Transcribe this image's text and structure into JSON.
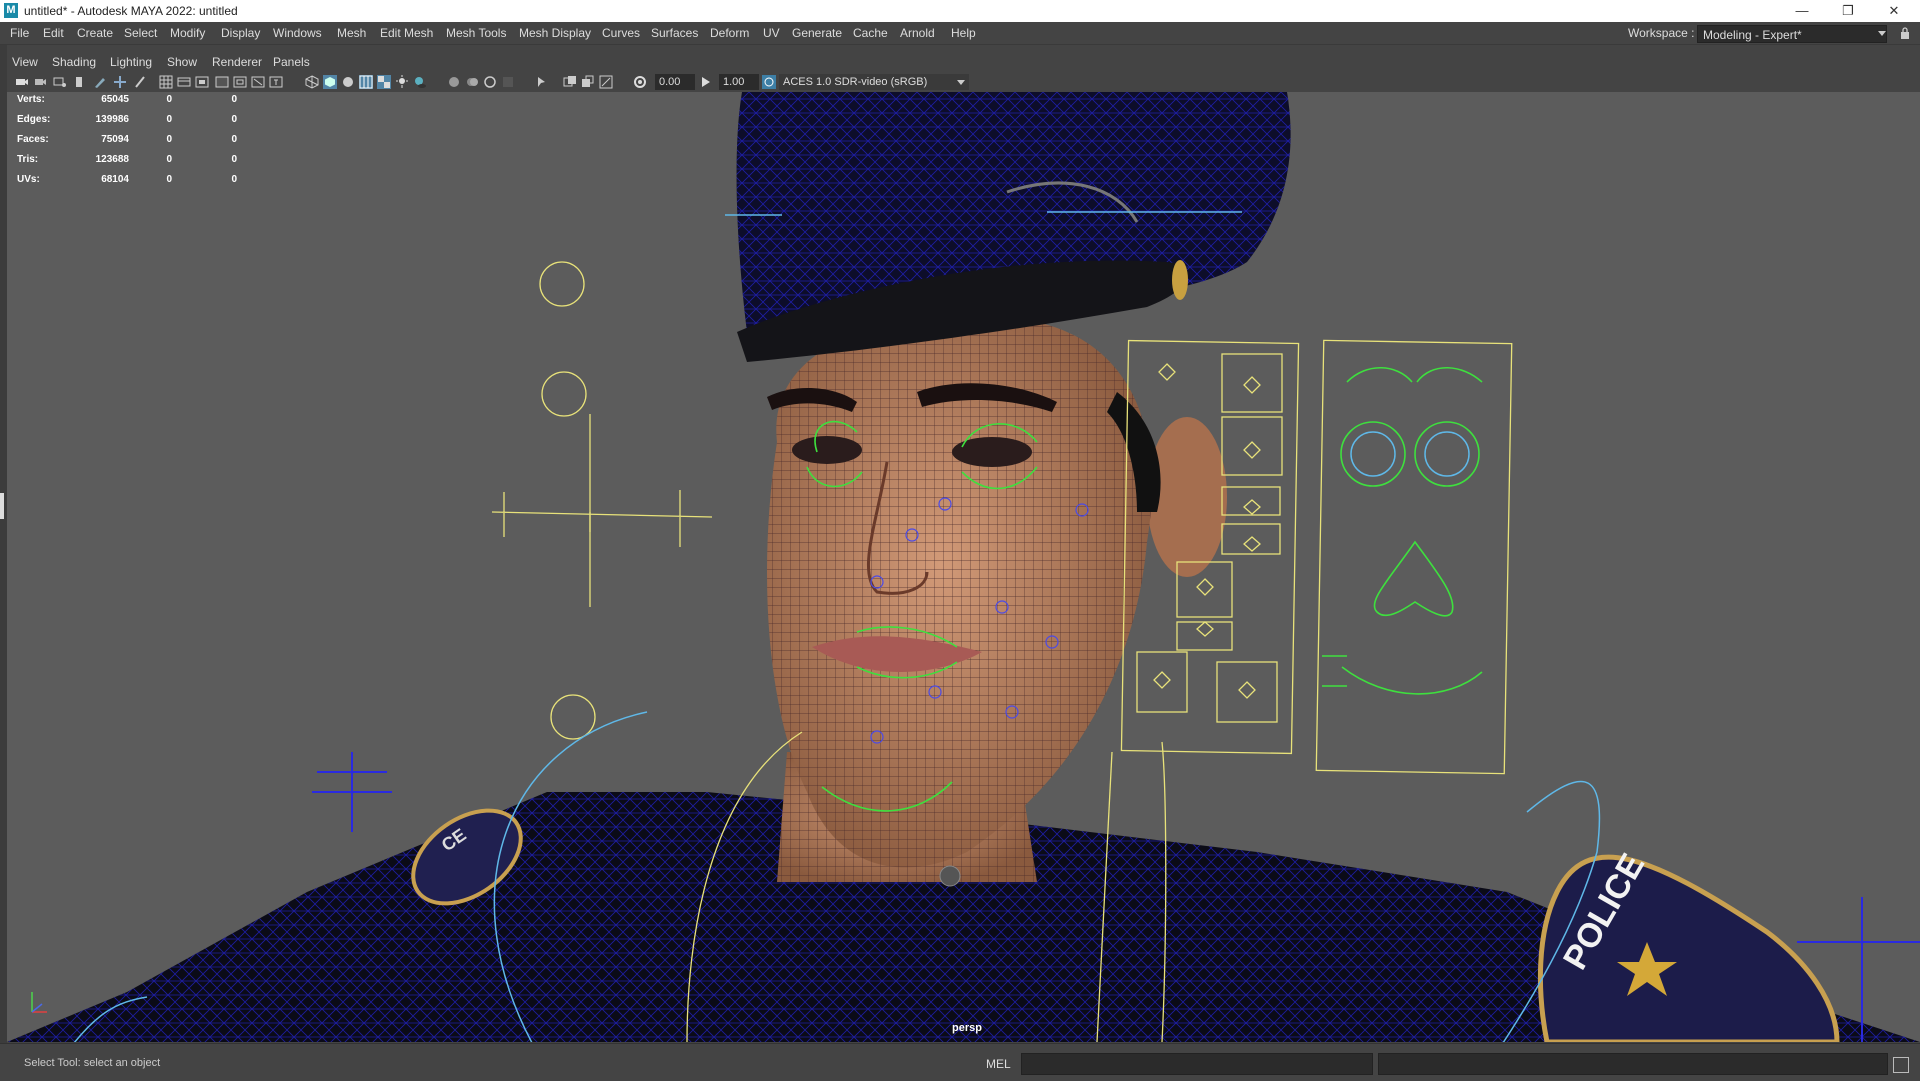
{
  "window": {
    "title": "untitled* - Autodesk MAYA 2022: untitled",
    "app_icon": "maya-icon",
    "controls": [
      "minimize-icon",
      "restore-icon",
      "close-icon"
    ]
  },
  "menubar": {
    "items": [
      "File",
      "Edit",
      "Create",
      "Select",
      "Modify",
      "Display",
      "Windows",
      "Mesh",
      "Edit Mesh",
      "Mesh Tools",
      "Mesh Display",
      "Curves",
      "Surfaces",
      "Deform",
      "UV",
      "Generate",
      "Cache",
      "Arnold",
      "Help"
    ],
    "workspace_label": "Workspace :",
    "workspace_value": "Modeling - Expert*"
  },
  "panel_menu": {
    "items": [
      "View",
      "Shading",
      "Lighting",
      "Show",
      "Renderer",
      "Panels"
    ]
  },
  "panel_toolbar": {
    "exposure_value": "0.00",
    "gamma_value": "1.00",
    "color_space": "ACES 1.0 SDR-video (sRGB)"
  },
  "hud": {
    "rows": [
      {
        "label": "Verts:",
        "a": "65045",
        "b": "0",
        "c": "0"
      },
      {
        "label": "Edges:",
        "a": "139986",
        "b": "0",
        "c": "0"
      },
      {
        "label": "Faces:",
        "a": "75094",
        "b": "0",
        "c": "0"
      },
      {
        "label": "Tris:",
        "a": "123688",
        "b": "0",
        "c": "0"
      },
      {
        "label": "UVs:",
        "a": "68104",
        "b": "0",
        "c": "0"
      }
    ]
  },
  "viewport": {
    "camera": "persp",
    "wire_color": "#1f1fb0",
    "skin_color": "#b07a5a",
    "control_yellow": "#e8e27a",
    "control_green": "#3ee03e",
    "control_blue": "#5fb8e8",
    "patch_text": "POLICE"
  },
  "statusbar": {
    "help_text": "Select Tool: select an object",
    "command_lang": "MEL"
  },
  "colors": {
    "ui_bg": "#444444",
    "viewport_bg": "#5c5c5c",
    "field_bg": "#2b2b2b"
  }
}
